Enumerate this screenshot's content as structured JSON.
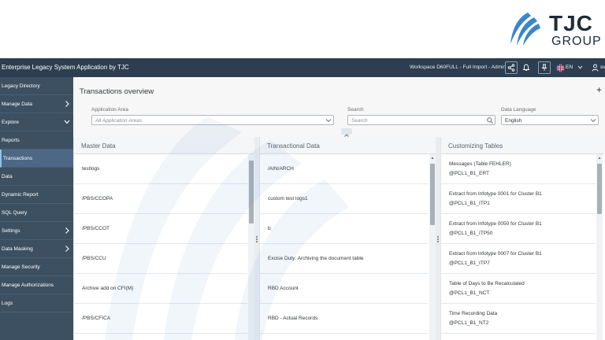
{
  "brand": {
    "name": "TJC",
    "tagline": "GROUP",
    "color": "#1f2a36",
    "accent": "#3b86c9"
  },
  "shell": {
    "title": "Enterprise Legacy System Application by TJC",
    "workspace": "Workspace D60FULL - Full Import - Admin",
    "language": "EN",
    "user": "sv",
    "icons": [
      "share-icon",
      "bell-icon",
      "pin-icon",
      "flag-uk-icon",
      "chevron-down-icon",
      "user-icon"
    ],
    "background": "#2c3e50"
  },
  "sidebar": {
    "background": "#3d5062",
    "items": [
      {
        "label": "Legacy Directory",
        "chevron": ""
      },
      {
        "label": "Manage Data",
        "chevron": "right"
      },
      {
        "label": "Explore",
        "chevron": "down"
      },
      {
        "label": "Reports",
        "chevron": ""
      },
      {
        "label": "Transactions",
        "chevron": "",
        "active": true
      },
      {
        "label": "Data",
        "chevron": ""
      },
      {
        "label": "Dynamic Report",
        "chevron": ""
      },
      {
        "label": "SQL Query",
        "chevron": ""
      },
      {
        "label": "Settings",
        "chevron": "right"
      },
      {
        "label": "Data Masking",
        "chevron": "right"
      },
      {
        "label": "Manage Security",
        "chevron": ""
      },
      {
        "label": "Manage Authorizations",
        "chevron": ""
      },
      {
        "label": "Logs",
        "chevron": ""
      }
    ]
  },
  "main": {
    "title": "Transactions overview",
    "add_label": "+",
    "filters": {
      "application_area": {
        "label": "Application Area",
        "value": "All Application Areas"
      },
      "search": {
        "label": "Search",
        "placeholder": "Search"
      },
      "data_language": {
        "label": "Data Language",
        "value": "English"
      }
    },
    "columns": [
      {
        "title": "Master Data",
        "rows": [
          {
            "line1": "testlogs"
          },
          {
            "line1": "/PBS/CCOPA"
          },
          {
            "line1": "/PBS/CCOT"
          },
          {
            "line1": "/PBS/CCU"
          },
          {
            "line1": "Archive add on CFI(M)"
          },
          {
            "line1": "/PBS/CFICA"
          }
        ]
      },
      {
        "title": "Transactional Data",
        "rows": [
          {
            "line1": "/AIN/ARCH"
          },
          {
            "line1": "custom test logs1"
          },
          {
            "line1": "b"
          },
          {
            "line1": "Excise Duty: Archiving the document table"
          },
          {
            "line1": "RBD Account"
          },
          {
            "line1": "RBD - Actual Records"
          }
        ]
      },
      {
        "title": "Customizing Tables",
        "rows": [
          {
            "line1": "Messages (Table FEHLER)",
            "line2": "@PCL1_B1_ERT"
          },
          {
            "line1": "Extract from Infotype 0001 for Cluster B1",
            "line2": "@PCL1_B1_ITP1"
          },
          {
            "line1": "Extract from Infotype 0050 for Cluster B1",
            "line2": "@PCL1_B1_ITP50"
          },
          {
            "line1": "Extract from Infotype 0007 for Cluster B1",
            "line2": "@PCL1_B1_ITP7"
          },
          {
            "line1": "Table of Days to Be Recalculated",
            "line2": "@PCL1_B1_NCT"
          },
          {
            "line1": "Time Recording Data",
            "line2": "@PCL1_B1_NT2"
          }
        ]
      }
    ]
  }
}
